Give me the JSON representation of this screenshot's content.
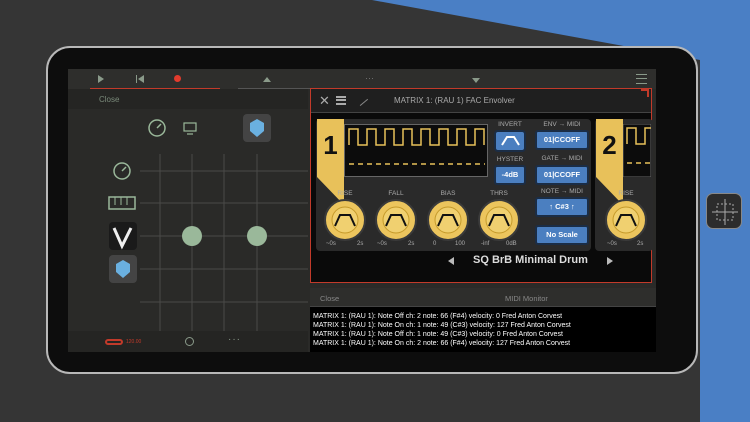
{
  "colors": {
    "accent_red": "#c23a2a",
    "knob_yellow": "#ecc55d",
    "button_blue": "#4b7fc0",
    "background_blue": "#4a7fc5"
  },
  "top_bar": {
    "more_icon": "···"
  },
  "left_panel": {
    "close_label": "Close",
    "tempo": "120.00"
  },
  "plugin": {
    "title": "MATRIX 1: (RAU 1) FAC Envolver",
    "unit1_number": "1",
    "unit2_number": "2",
    "invert_label": "INVERT",
    "hyster_label": "HYSTER",
    "hyster_value": "-4dB",
    "env_midi_label": "ENV → MIDI",
    "env_midi_value": "01|CCOFF",
    "gate_midi_label": "GATE → MIDI",
    "gate_midi_value": "01|CCOFF",
    "note_midi_label": "NOTE → MIDI",
    "note_midi_value": "↑ C#3 ↑",
    "scale_value": "No Scale",
    "knobs": [
      {
        "label": "RISE",
        "min": "~0s",
        "max": "2s"
      },
      {
        "label": "FALL",
        "min": "~0s",
        "max": "2s"
      },
      {
        "label": "BIAS",
        "min": "0",
        "max": "100"
      },
      {
        "label": "THRS",
        "min": "-inf",
        "max": "0dB"
      }
    ],
    "unit2_rise_label": "RISE",
    "unit2_rise_min": "~0s",
    "unit2_rise_max": "2s",
    "preset_name": "SQ BrB Minimal Drum"
  },
  "midi_monitor": {
    "close_label": "Close",
    "title": "MIDI Monitor",
    "lines": [
      "MATRIX 1: (RAU 1): Note Off ch: 2 note: 66 (F#4) velocity: 0 Fred Anton Corvest",
      "MATRIX 1: (RAU 1): Note On ch: 1 note: 49 (C#3) velocity: 127 Fred Anton Corvest",
      "MATRIX 1: (RAU 1): Note Off ch: 1 note: 49 (C#3) velocity: 0 Fred Anton Corvest",
      "MATRIX 1: (RAU 1): Note On ch: 2 note: 66 (F#4) velocity: 127 Fred Anton Corvest"
    ]
  }
}
